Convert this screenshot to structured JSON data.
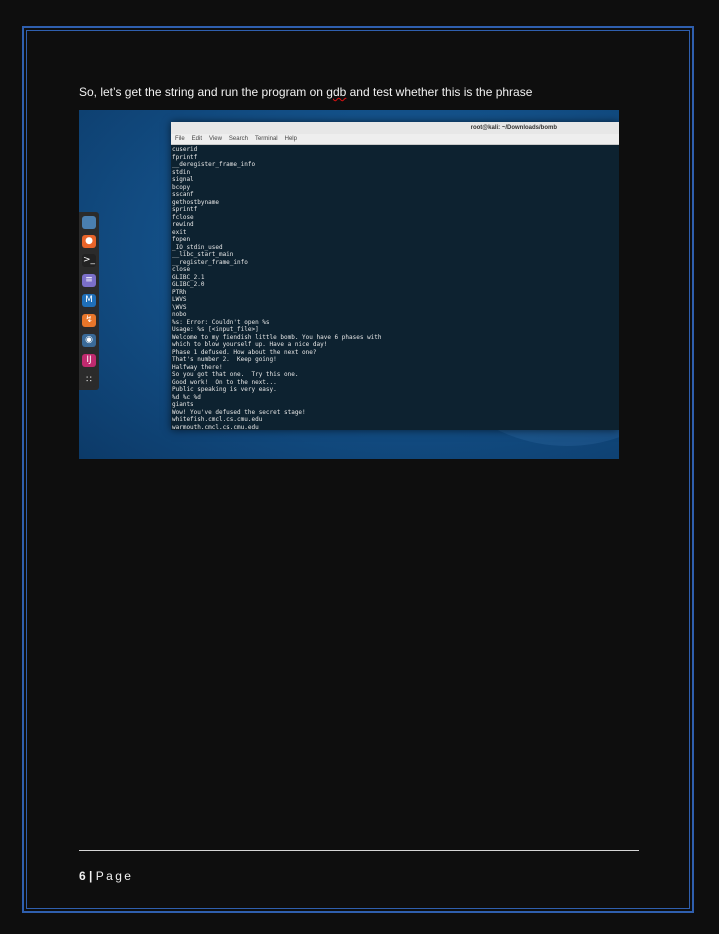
{
  "intro": {
    "before": "So, let’s get the string and run the program on ",
    "flagged": "gdb",
    "after": " and test whether this is the phrase"
  },
  "terminal": {
    "title": "root@kali: ~/Downloads/bomb",
    "menu": [
      "File",
      "Edit",
      "View",
      "Search",
      "Terminal",
      "Help"
    ],
    "lines": [
      "cuserid",
      "fprintf",
      "__deregister_frame_info",
      "stdin",
      "signal",
      "bcopy",
      "sscanf",
      "gethostbyname",
      "sprintf",
      "fclose",
      "rewind",
      "exit",
      "fopen",
      "_IO_stdin_used",
      "__libc_start_main",
      "__register_frame_info",
      "close",
      "GLIBC_2.1",
      "GLIBC_2.0",
      "PTRh",
      "LWVS",
      "\\WVS",
      "nobo",
      "%s: Error: Couldn't open %s",
      "Usage: %s [<input_file>]",
      "Welcome to my fiendish little bomb. You have 6 phases with",
      "which to blow yourself up. Have a nice day!",
      "Phase 1 defused. How about the next one?",
      "That's number 2.  Keep going!",
      "Halfway there!",
      "So you got that one.  Try this one.",
      "Good work!  On to the next...",
      "Public speaking is very easy.",
      "%d %c %d",
      "giants",
      "Wow! You've defused the secret stage!",
      "whitefish.cmcl.cs.cmu.edu",
      "warmouth.cmcl.cs.cmu.edu"
    ]
  },
  "dock": {
    "icons": [
      {
        "name": "files-icon",
        "color": "#4a7fb0",
        "glyph": ""
      },
      {
        "name": "firefox-icon",
        "color": "#e8642a",
        "glyph": "●"
      },
      {
        "name": "terminal-icon",
        "color": "#222222",
        "glyph": ">_"
      },
      {
        "name": "text-editor-icon",
        "color": "#7b6fc9",
        "glyph": "≡"
      },
      {
        "name": "metasploit-icon",
        "color": "#1f6fb8",
        "glyph": "M"
      },
      {
        "name": "burp-suite-icon",
        "color": "#e8762a",
        "glyph": "↯"
      },
      {
        "name": "eye-icon",
        "color": "#3a6a98",
        "glyph": "◉"
      },
      {
        "name": "ide-icon",
        "color": "#c02a6f",
        "glyph": "IJ"
      },
      {
        "name": "app-grid-icon",
        "color": "#2b2b2b",
        "glyph": "∷"
      }
    ]
  },
  "footer": {
    "page_number": "6",
    "separator": " | ",
    "page_word": "Page"
  }
}
